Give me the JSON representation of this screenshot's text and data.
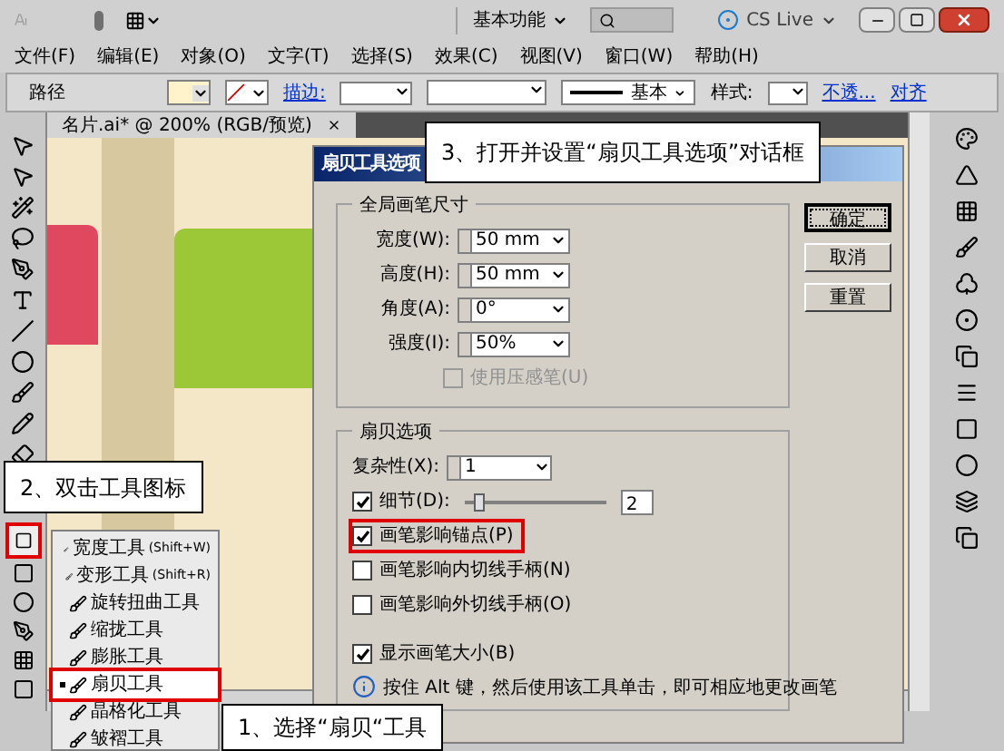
{
  "title_bar": {
    "workspace": "基本功能",
    "cs_live": "CS Live"
  },
  "menu_bar": [
    {
      "label": "文件(F)"
    },
    {
      "label": "编辑(E)"
    },
    {
      "label": "对象(O)"
    },
    {
      "label": "文字(T)"
    },
    {
      "label": "选择(S)"
    },
    {
      "label": "效果(C)"
    },
    {
      "label": "视图(V)"
    },
    {
      "label": "窗口(W)"
    },
    {
      "label": "帮助(H)"
    }
  ],
  "control_bar": {
    "object_type": "路径",
    "stroke_label": "描边:",
    "stroke_profile": "基本",
    "style_label": "样式:",
    "opacity_link": "不透...",
    "align_link": "对齐"
  },
  "document_tab": {
    "title": "名片.ai* @ 200% (RGB/预览)"
  },
  "toolbar": {
    "scallop_tool_highlighted": true
  },
  "tool_flyout": [
    {
      "label": "宽度工具",
      "shortcut": "(Shift+W)",
      "selected": false
    },
    {
      "label": "变形工具",
      "shortcut": "(Shift+R)",
      "selected": false
    },
    {
      "label": "旋转扭曲工具",
      "selected": false
    },
    {
      "label": "缩拢工具",
      "selected": false
    },
    {
      "label": "膨胀工具",
      "selected": false
    },
    {
      "label": "扇贝工具",
      "selected": true
    },
    {
      "label": "晶格化工具",
      "selected": false
    },
    {
      "label": "皱褶工具",
      "selected": false
    }
  ],
  "dialog": {
    "title": "扇贝工具选项",
    "global_brush_size": {
      "legend": "全局画笔尺寸",
      "fields": [
        {
          "label": "宽度(W):",
          "value": "50 mm"
        },
        {
          "label": "高度(H):",
          "value": "50 mm"
        },
        {
          "label": "角度(A):",
          "value": "0°"
        },
        {
          "label": "强度(I):",
          "value": "50%"
        }
      ],
      "pressure_pen": {
        "label": "使用压感笔(U)",
        "checked": false,
        "disabled": true
      }
    },
    "buttons": [
      {
        "label": "确定",
        "default": true
      },
      {
        "label": "取消",
        "default": false
      },
      {
        "label": "重置",
        "default": false
      }
    ],
    "scallop_options": {
      "legend": "扇贝选项",
      "complexity": {
        "label": "复杂性(X):",
        "value": "1"
      },
      "detail": {
        "label": "细节(D):",
        "checked": true,
        "level": 0.1,
        "value": "2"
      },
      "checkboxes": [
        {
          "label": "画笔影响锚点(P)",
          "checked": true,
          "highlighted": true
        },
        {
          "label": "画笔影响内切线手柄(N)",
          "checked": false,
          "highlighted": false
        },
        {
          "label": "画笔影响外切线手柄(O)",
          "checked": false,
          "highlighted": false
        }
      ],
      "show_brush_size": {
        "label": "显示画笔大小(B)",
        "checked": true
      },
      "hint": "按住 Alt 键，然后使用该工具单击，即可相应地更改画笔"
    }
  },
  "callouts": [
    {
      "text": "3、打开并设置“扇贝工具选项”对话框"
    },
    {
      "text": "2、双击工具图标"
    },
    {
      "text": "1、选择“扇贝“工具"
    }
  ]
}
